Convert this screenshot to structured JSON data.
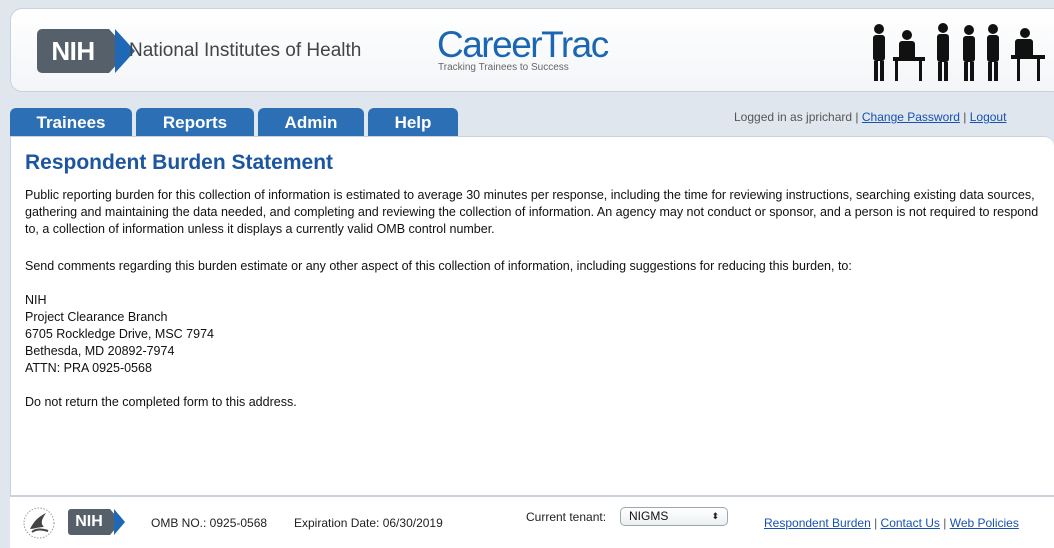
{
  "header": {
    "nih_badge": "NIH",
    "nih_name": "National Institutes of Health",
    "app_title": "CareerTrac",
    "app_tagline": "Tracking Trainees to Success",
    "people_icon": "people-silhouettes-icon"
  },
  "tabs": [
    {
      "label": "Trainees"
    },
    {
      "label": "Reports"
    },
    {
      "label": "Admin"
    },
    {
      "label": "Help"
    }
  ],
  "login": {
    "prefix": "Logged in as jprichard | ",
    "change_password": "Change Password",
    "sep": " | ",
    "logout": "Logout"
  },
  "content": {
    "title": "Respondent Burden Statement",
    "para1": "Public reporting burden for this collection of information is estimated to average 30 minutes per response, including the time for reviewing instructions, searching existing data sources, gathering and maintaining the data needed, and completing and reviewing the collection of information. An agency may not conduct or sponsor, and a person is not required to respond to, a collection of information unless it displays a currently valid OMB control number.",
    "para2": "Send comments regarding this burden estimate or any other aspect of this collection of information, including suggestions for reducing this burden, to:",
    "address": [
      "NIH",
      "Project Clearance Branch",
      "6705 Rockledge Drive, MSC 7974",
      "Bethesda, MD 20892-7974",
      "ATTN: PRA 0925-0568"
    ],
    "para3": "Do not return the completed form to this address."
  },
  "footer": {
    "nih_badge": "NIH",
    "omb": "OMB NO.: 0925-0568",
    "expiration": "Expiration Date: 06/30/2019",
    "tenant_label": "Current tenant:",
    "tenant_value": "NIGMS",
    "tenant_arrow": "⬍",
    "links": {
      "respondent_burden": "Respondent Burden",
      "contact_us": "Contact Us",
      "web_policies": "Web Policies",
      "sep": " | "
    }
  },
  "colors": {
    "tab_blue": "#2d6fb5",
    "title_blue": "#1d56a0",
    "nih_gray": "#56606b",
    "link_blue": "#1652b0"
  }
}
